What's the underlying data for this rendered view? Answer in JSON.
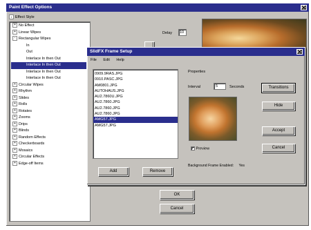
{
  "main_window": {
    "title": "Paint Effect Options",
    "tree_header": "Effect Style",
    "tree_items": [
      {
        "label": "No Effect",
        "indent": 0,
        "expander": "+"
      },
      {
        "label": "Linear Wipes",
        "indent": 0,
        "expander": "+"
      },
      {
        "label": "Rectangular Wipes",
        "indent": 0,
        "expander": "-"
      },
      {
        "label": "In",
        "indent": 1,
        "expander": ""
      },
      {
        "label": "Out",
        "indent": 1,
        "expander": ""
      },
      {
        "label": "Interlace In then Out",
        "indent": 1,
        "expander": ""
      },
      {
        "label": "Interlace In then Out",
        "indent": 1,
        "expander": "",
        "selected": true
      },
      {
        "label": "Interlace In then Out",
        "indent": 1,
        "expander": ""
      },
      {
        "label": "Interlace In then Out",
        "indent": 1,
        "expander": ""
      },
      {
        "label": "Circular Wipes",
        "indent": 0,
        "expander": "+"
      },
      {
        "label": "Rhythm",
        "indent": 0,
        "expander": "+"
      },
      {
        "label": "Slides",
        "indent": 0,
        "expander": "+"
      },
      {
        "label": "Rolls",
        "indent": 0,
        "expander": "+"
      },
      {
        "label": "Rotates",
        "indent": 0,
        "expander": "+"
      },
      {
        "label": "Zooms",
        "indent": 0,
        "expander": "+"
      },
      {
        "label": "Drips",
        "indent": 0,
        "expander": "+"
      },
      {
        "label": "Blinds",
        "indent": 0,
        "expander": "+"
      },
      {
        "label": "Random Effects",
        "indent": 0,
        "expander": "+"
      },
      {
        "label": "Checkerboards",
        "indent": 0,
        "expander": "+"
      },
      {
        "label": "Mosaics",
        "indent": 0,
        "expander": "+"
      },
      {
        "label": "Circular Effects",
        "indent": 0,
        "expander": "+"
      },
      {
        "label": "Edge-off Items",
        "indent": 0,
        "expander": "+"
      }
    ],
    "delay_label": "Delay",
    "delay_value": "10",
    "ok_label": "OK",
    "cancel_label": "Cancel"
  },
  "dialog": {
    "title": "SlidFX Frame Setup",
    "menu": [
      "File",
      "Edit",
      "Help"
    ],
    "files": [
      {
        "name": "0909.9RAS.JPG"
      },
      {
        "name": "0910.PASC.JPG"
      },
      {
        "name": "AM0801.JPG"
      },
      {
        "name": "AUTOHAUS.JPG"
      },
      {
        "name": "AU2.7860U.JPG"
      },
      {
        "name": "AU2.7860.JPG"
      },
      {
        "name": "AU2.7860.JPG"
      },
      {
        "name": "AU2.7860.JPG"
      },
      {
        "name": "AMG57.JPG",
        "selected": true
      },
      {
        "name": "AMG57.JPG"
      }
    ],
    "add_label": "Add",
    "remove_label": "Remove",
    "properties_label": "Properties",
    "interval_label": "Interval",
    "interval_value": "5",
    "seconds_label": "Seconds",
    "transitions_label": "Transitions",
    "hide_label": "Hide",
    "accept_label": "Accept",
    "cancel_label": "Cancel",
    "preview_label": "Preview",
    "status_label": "Background Frame Enabled:",
    "status_value": "Yes"
  }
}
